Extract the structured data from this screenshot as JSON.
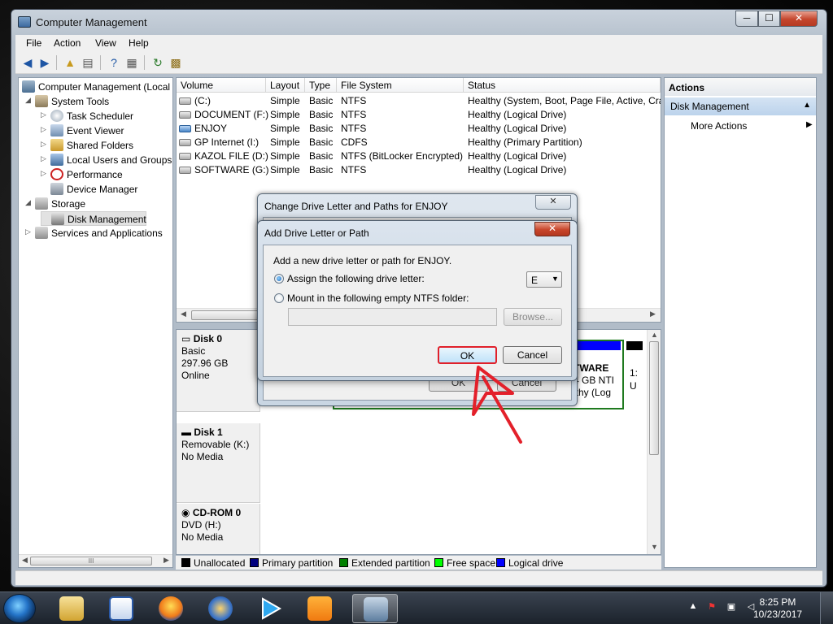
{
  "window": {
    "title": "Computer Management",
    "caption_min": "─",
    "caption_max": "☐",
    "caption_close": "✕"
  },
  "menu": [
    "File",
    "Action",
    "View",
    "Help"
  ],
  "tree": {
    "root": "Computer Management (Local",
    "items": [
      {
        "label": "System Tools"
      },
      {
        "label": "Task Scheduler"
      },
      {
        "label": "Event Viewer"
      },
      {
        "label": "Shared Folders"
      },
      {
        "label": "Local Users and Groups"
      },
      {
        "label": "Performance"
      },
      {
        "label": "Device Manager"
      },
      {
        "label": "Storage"
      },
      {
        "label": "Disk Management"
      },
      {
        "label": "Services and Applications"
      }
    ],
    "hscroll_grip": "III"
  },
  "volumes": {
    "headers": [
      "Volume",
      "Layout",
      "Type",
      "File System",
      "Status"
    ],
    "rows": [
      [
        "(C:)",
        "Simple",
        "Basic",
        "NTFS",
        "Healthy (System, Boot, Page File, Active, Cras"
      ],
      [
        "DOCUMENT (F:)",
        "Simple",
        "Basic",
        "NTFS",
        "Healthy (Logical Drive)"
      ],
      [
        "ENJOY",
        "Simple",
        "Basic",
        "NTFS",
        "Healthy (Logical Drive)"
      ],
      [
        "GP Internet (I:)",
        "Simple",
        "Basic",
        "CDFS",
        "Healthy (Primary Partition)"
      ],
      [
        "KAZOL FILE (D:)",
        "Simple",
        "Basic",
        "NTFS (BitLocker Encrypted)",
        "Healthy (Logical Drive)"
      ],
      [
        "SOFTWARE (G:)",
        "Simple",
        "Basic",
        "NTFS",
        "Healthy (Logical Drive)"
      ]
    ]
  },
  "disks": [
    {
      "name": "Disk 0",
      "line1": "Basic",
      "line2": "297.96 GB",
      "line3": "Online"
    },
    {
      "name": "Disk 1",
      "line1": "Removable (K:)",
      "line2": "",
      "line3": "No Media"
    },
    {
      "name": "CD-ROM 0",
      "line1": "DVD (H:)",
      "line2": "",
      "line3": "No Media"
    }
  ],
  "disk0_partial": {
    "software_title": "TWARE",
    "software_size": "4 GB NTI",
    "software_status": "lthy (Log",
    "tail1": "1:",
    "tail2": "U"
  },
  "legend": [
    {
      "label": "Unallocated",
      "color": "#000000"
    },
    {
      "label": "Primary partition",
      "color": "#00007f"
    },
    {
      "label": "Extended partition",
      "color": "#008000"
    },
    {
      "label": "Free space",
      "color": "#00ff00"
    },
    {
      "label": "Logical drive",
      "color": "#0000ff"
    }
  ],
  "actions": {
    "header": "Actions",
    "section": "Disk Management",
    "more": "More Actions"
  },
  "dialog_back": {
    "title": "Change Drive Letter and Paths for ENJOY",
    "close": "✕",
    "ok": "OK",
    "cancel": "Cancel"
  },
  "dialog_front": {
    "title": "Add Drive Letter or Path",
    "close": "✕",
    "instruction": "Add a new drive letter or path for ENJOY.",
    "option_assign": "Assign the following drive letter:",
    "option_mount": "Mount in the following empty NTFS folder:",
    "drive_letter": "E",
    "browse": "Browse...",
    "ok": "OK",
    "cancel": "Cancel",
    "ok_highlight_color": "#e0202a"
  },
  "taskbar": {
    "time": "8:25 PM",
    "date": "10/23/2017",
    "tray_arrow": "▲"
  }
}
